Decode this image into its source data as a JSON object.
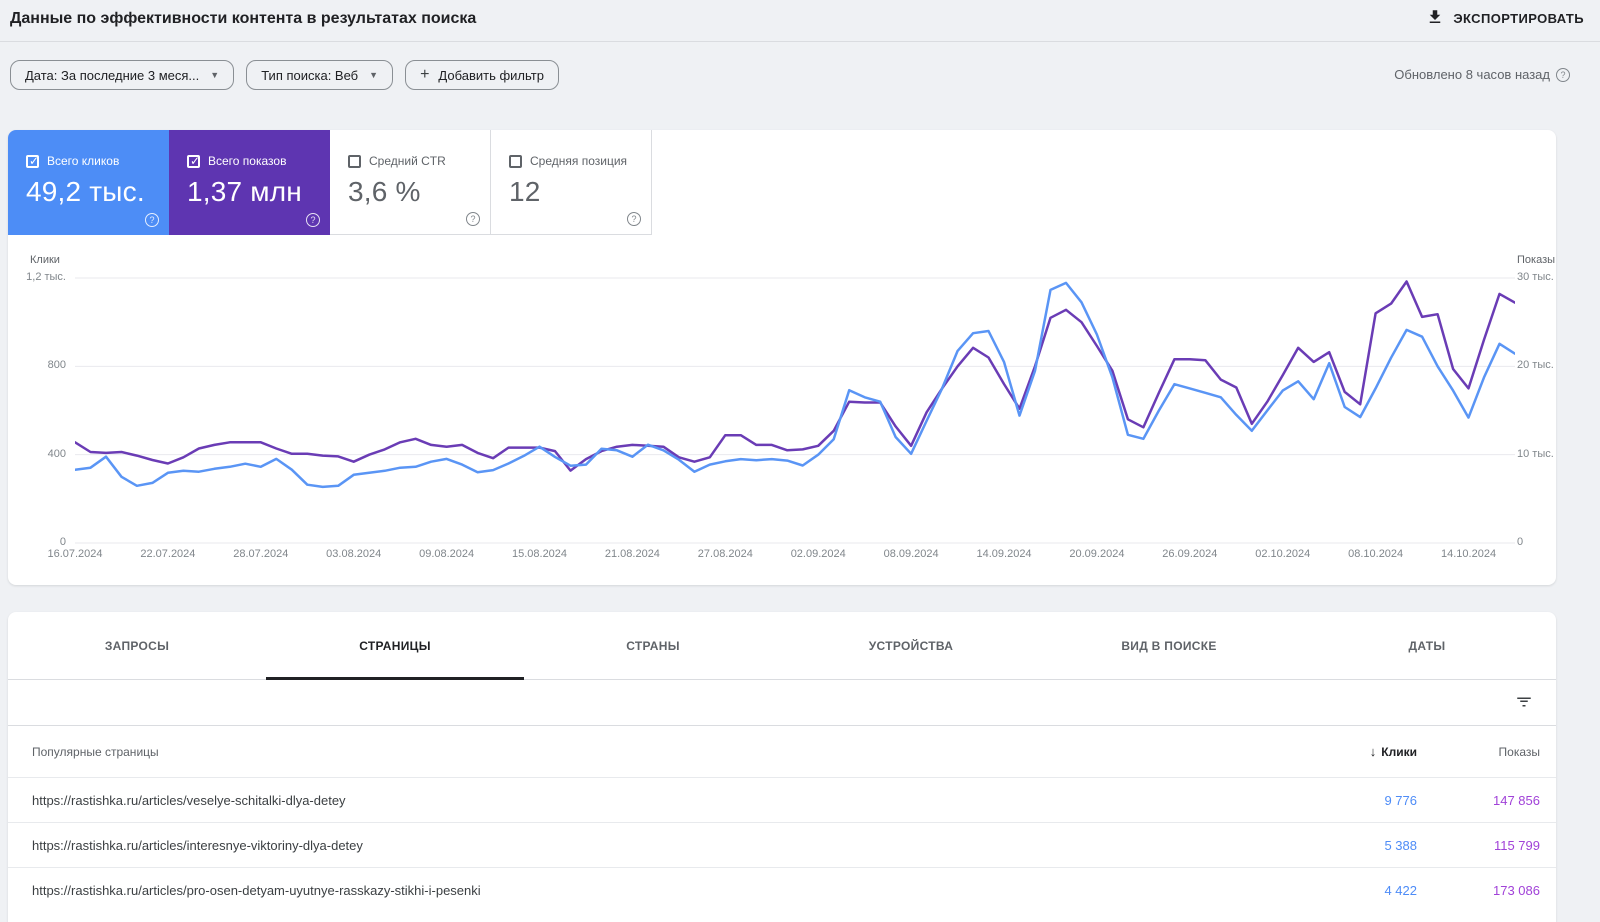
{
  "page": {
    "title": "Данные по эффективности контента в результатах поиска",
    "export_label": "ЭКСПОРТИРОВАТЬ",
    "updated": "Обновлено 8 часов назад"
  },
  "filters": {
    "date_chip": "Дата: За последние 3 меся...",
    "search_type_chip": "Тип поиска: Веб",
    "add_filter_chip": "Добавить фильтр"
  },
  "metrics": [
    {
      "label": "Всего кликов",
      "value": "49,2 тыс.",
      "checked": true,
      "bg": "#4d8df6",
      "fg": "#ffffff"
    },
    {
      "label": "Всего показов",
      "value": "1,37 млн",
      "checked": true,
      "bg": "#5e35b1",
      "fg": "#ffffff"
    },
    {
      "label": "Средний CTR",
      "value": "3,6 %",
      "checked": false,
      "bg": "#ffffff",
      "fg": "#5f6368"
    },
    {
      "label": "Средняя позиция",
      "value": "12",
      "checked": false,
      "bg": "#ffffff",
      "fg": "#5f6368"
    }
  ],
  "chart_data": {
    "type": "line",
    "left_axis": {
      "title": "Клики",
      "ticks": [
        "1,2 тыс.",
        "800",
        "400",
        "0"
      ],
      "max": 1200,
      "min": 0
    },
    "right_axis": {
      "title": "Показы",
      "ticks": [
        "30 тыс.",
        "20 тыс.",
        "10 тыс.",
        "0"
      ],
      "max": 30,
      "min": 0,
      "unit": "тыс."
    },
    "x_labels": [
      "16.07.2024",
      "22.07.2024",
      "28.07.2024",
      "03.08.2024",
      "09.08.2024",
      "15.08.2024",
      "21.08.2024",
      "27.08.2024",
      "02.09.2024",
      "08.09.2024",
      "14.09.2024",
      "20.09.2024",
      "26.09.2024",
      "02.10.2024",
      "08.10.2024",
      "14.10.2024"
    ],
    "grid": true,
    "legend_position": "none",
    "series": [
      {
        "name": "Показы (тыс.)",
        "axis": "right",
        "color": "#6a3cb5",
        "values": [
          11.4,
          10.3,
          10.2,
          10.3,
          9.9,
          9.4,
          9.0,
          9.7,
          10.7,
          11.1,
          11.4,
          11.4,
          11.4,
          10.7,
          10.1,
          10.1,
          9.9,
          9.8,
          9.2,
          10.0,
          10.6,
          11.4,
          11.8,
          11.1,
          10.9,
          11.1,
          10.2,
          9.6,
          10.8,
          10.8,
          10.8,
          10.4,
          8.2,
          9.5,
          10.4,
          10.9,
          11.1,
          11.0,
          10.9,
          9.7,
          9.2,
          9.7,
          12.2,
          12.2,
          11.1,
          11.1,
          10.5,
          10.6,
          11.0,
          12.7,
          16.0,
          15.9,
          15.9,
          13.2,
          11.0,
          14.8,
          17.5,
          20.0,
          22.1,
          21.0,
          18.0,
          15.2,
          20.0,
          25.5,
          26.4,
          25.0,
          22.3,
          19.5,
          14.0,
          13.1,
          17.0,
          20.8,
          20.8,
          20.7,
          18.5,
          17.6,
          13.5,
          16.0,
          19.0,
          22.1,
          20.5,
          21.6,
          17.1,
          15.7,
          26.0,
          27.1,
          29.6,
          25.6,
          25.9,
          19.7,
          17.5,
          23.0,
          28.2,
          27.2
        ]
      },
      {
        "name": "Клики",
        "axis": "left",
        "color": "#5a95f5",
        "values": [
          332,
          341,
          391,
          300,
          259,
          272,
          318,
          327,
          323,
          336,
          345,
          359,
          345,
          381,
          332,
          264,
          254,
          259,
          309,
          318,
          327,
          341,
          345,
          368,
          381,
          355,
          320,
          330,
          360,
          395,
          436,
          390,
          350,
          355,
          427,
          420,
          391,
          445,
          420,
          377,
          323,
          355,
          370,
          380,
          375,
          380,
          373,
          351,
          400,
          470,
          692,
          660,
          640,
          480,
          404,
          553,
          700,
          870,
          950,
          960,
          820,
          577,
          780,
          1146,
          1178,
          1090,
          944,
          750,
          490,
          472,
          600,
          719,
          700,
          680,
          660,
          580,
          508,
          600,
          690,
          732,
          651,
          814,
          616,
          570,
          700,
          839,
          965,
          934,
          800,
          690,
          568,
          750,
          902,
          857
        ]
      }
    ]
  },
  "tabs": [
    {
      "label": "ЗАПРОСЫ",
      "active": false
    },
    {
      "label": "СТРАНИЦЫ",
      "active": true
    },
    {
      "label": "СТРАНЫ",
      "active": false
    },
    {
      "label": "УСТРОЙСТВА",
      "active": false
    },
    {
      "label": "ВИД В ПОИСКЕ",
      "active": false
    },
    {
      "label": "ДАТЫ",
      "active": false
    }
  ],
  "table": {
    "first_col_header": "Популярные страницы",
    "clicks_header": "Клики",
    "impressions_header": "Показы",
    "sort_arrow": "↓",
    "rows": [
      {
        "url": "https://rastishka.ru/articles/veselye-schitalki-dlya-detey",
        "clicks": "9 776",
        "impressions": "147 856"
      },
      {
        "url": "https://rastishka.ru/articles/interesnye-viktoriny-dlya-detey",
        "clicks": "5 388",
        "impressions": "115 799"
      },
      {
        "url": "https://rastishka.ru/articles/pro-osen-detyam-uyutnye-rasskazy-stikhi-i-pesenki",
        "clicks": "4 422",
        "impressions": "173 086"
      }
    ]
  },
  "colors": {
    "page_bg": "#eff1f4",
    "panel_bg": "#ffffff",
    "divider": "#dadce0",
    "clicks_accent": "#4d8df6",
    "impressions_accent": "#5e35b1",
    "clicks_line": "#5a95f5",
    "impressions_line": "#6a3cb5",
    "table_clicks_value": "#4e8cf7",
    "table_impressions_value": "#a142d8",
    "gridline": "#e9eaee"
  }
}
